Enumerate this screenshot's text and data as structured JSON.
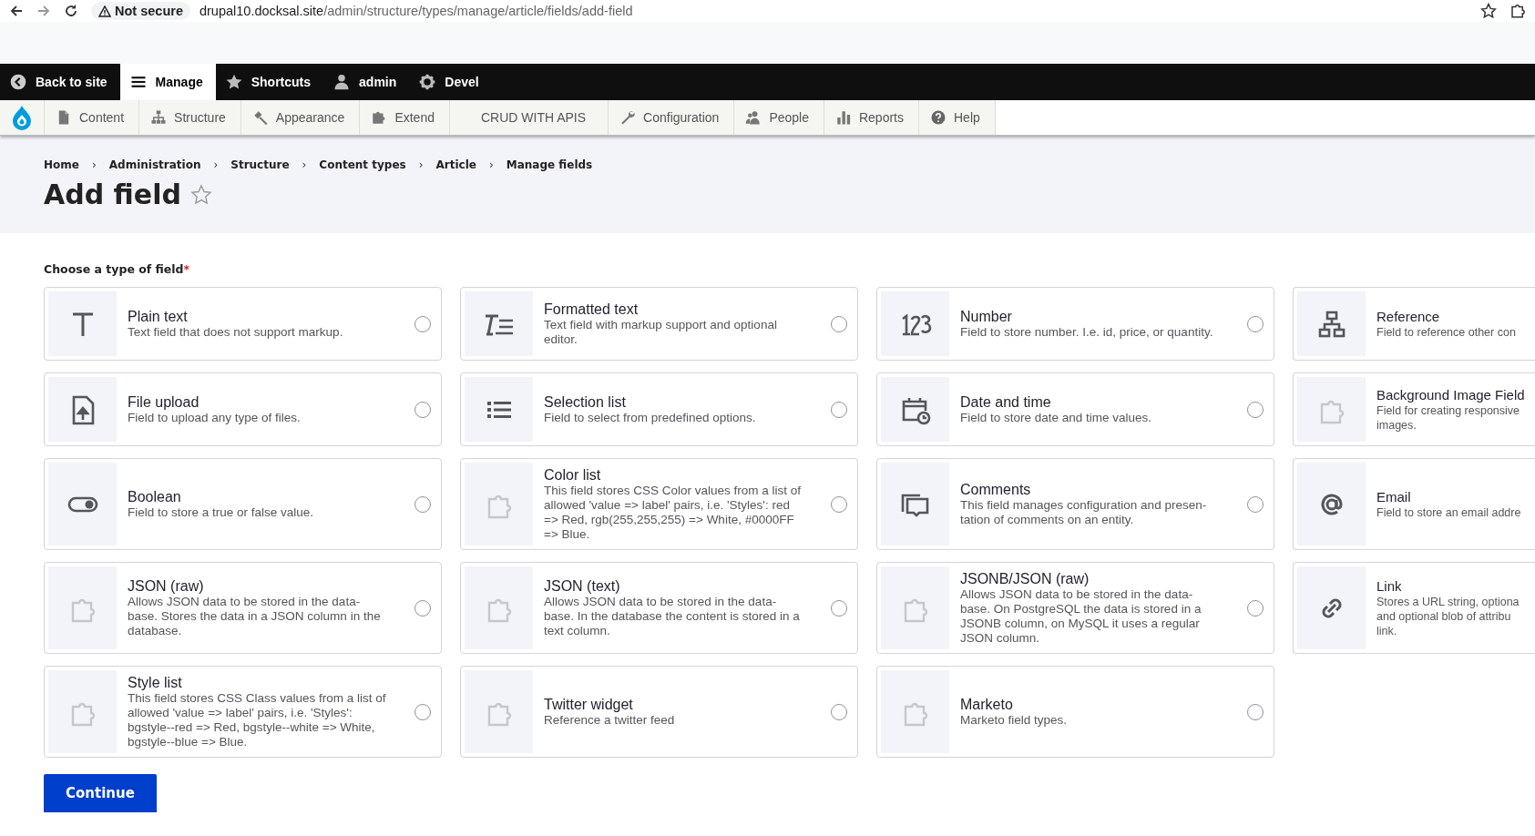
{
  "browser": {
    "security": "Not secure",
    "url_host": "drupal10.docksal.site",
    "url_path": "/admin/structure/types/manage/article/fields/add-field"
  },
  "toolbar": {
    "items": [
      {
        "label": "Back to site",
        "kind": "back",
        "selected": false
      },
      {
        "label": "Manage",
        "kind": "menu",
        "selected": true
      },
      {
        "label": "Shortcuts",
        "kind": "star",
        "selected": false
      },
      {
        "label": "admin",
        "kind": "user",
        "selected": false
      },
      {
        "label": "Devel",
        "kind": "gear",
        "selected": false
      }
    ]
  },
  "tray": {
    "items": [
      {
        "label": "Content",
        "kind": "file"
      },
      {
        "label": "Structure",
        "kind": "sitemap"
      },
      {
        "label": "Appearance",
        "kind": "brush"
      },
      {
        "label": "Extend",
        "kind": "puzzle"
      },
      {
        "label": "CRUD WITH APIS",
        "kind": "plain"
      },
      {
        "label": "Configuration",
        "kind": "wrench"
      },
      {
        "label": "People",
        "kind": "people"
      },
      {
        "label": "Reports",
        "kind": "bars"
      },
      {
        "label": "Help",
        "kind": "help"
      }
    ]
  },
  "breadcrumb": [
    {
      "label": "Home"
    },
    {
      "separator": "›",
      "label": "Administration"
    },
    {
      "separator": "›",
      "label": "Structure"
    },
    {
      "separator": "›",
      "label": "Content types"
    },
    {
      "separator": "›",
      "label": "Article"
    },
    {
      "separator": "›",
      "label": "Manage fields"
    }
  ],
  "title": "Add field",
  "form": {
    "label": "Choose a type of field",
    "required_mark": "*",
    "options": [
      {
        "title": "Plain text",
        "description": "Text field that does not support markup.",
        "kind": "text",
        "selected": false
      },
      {
        "title": "Formatted text",
        "description": "Text field with markup support and optional\neditor.",
        "kind": "formatted",
        "selected": false
      },
      {
        "title": "Number",
        "description": "Field to store number. I.e. id, price, or quantity.",
        "kind": "number",
        "selected": false
      },
      {
        "title": "Reference",
        "description": "Field to reference other con",
        "kind": "reference"
      },
      {
        "title": "File upload",
        "description": "Field to upload any type of files.",
        "kind": "file",
        "selected": false
      },
      {
        "title": "Selection list",
        "description": "Field to select from predefined options.",
        "kind": "list",
        "selected": false
      },
      {
        "title": "Date and time",
        "description": "Field to store date and time values.",
        "kind": "calendar",
        "selected": false
      },
      {
        "title": "Background Image Field",
        "description": "Field for creating responsive\nimages.",
        "kind": "puzzle"
      },
      {
        "title": "Boolean",
        "description": "Field to store a true or false value.",
        "kind": "toggle",
        "selected": false
      },
      {
        "title": "Color list",
        "description": "This field stores CSS Color values from a list of\nallowed 'value => label' pairs, i.e. 'Styles': red\n=> Red, rgb(255,255,255) => White, #0000FF\n=> Blue.",
        "kind": "puzzle",
        "selected": false
      },
      {
        "title": "Comments",
        "description": "This field manages configuration and presen-\ntation of comments on an entity.",
        "kind": "comments",
        "selected": false
      },
      {
        "title": "Email",
        "description": "Field to store an email addre",
        "kind": "at"
      },
      {
        "title": "JSON (raw)",
        "description": "Allows JSON data to be stored in the data-\nbase. Stores the data in a JSON column in the\ndatabase.",
        "kind": "puzzle",
        "selected": false
      },
      {
        "title": "JSON (text)",
        "description": "Allows JSON data to be stored in the data-\nbase. In the database the content is stored in a\ntext column.",
        "kind": "puzzle",
        "selected": false
      },
      {
        "title": "JSONB/JSON (raw)",
        "description": "Allows JSON data to be stored in the data-\nbase. On PostgreSQL the data is stored in a\nJSONB column, on MySQL it uses a regular\nJSON column.",
        "kind": "puzzle",
        "selected": false
      },
      {
        "title": "Link",
        "description": "Stores a URL string, optiona\nand optional blob of attribu\nlink.",
        "kind": "link"
      },
      {
        "title": "Style list",
        "description": "This field stores CSS Class values from a list of\nallowed 'value => label' pairs, i.e. 'Styles':\nbgstyle--red => Red, bgstyle--white => White,\nbgstyle--blue => Blue.",
        "kind": "puzzle",
        "selected": false
      },
      {
        "title": "Twitter widget",
        "description": "Reference a twitter feed",
        "kind": "puzzle",
        "selected": false
      },
      {
        "title": "Marketo",
        "description": "Marketo field types.",
        "kind": "puzzle",
        "selected": false
      }
    ]
  },
  "button": "Continue"
}
